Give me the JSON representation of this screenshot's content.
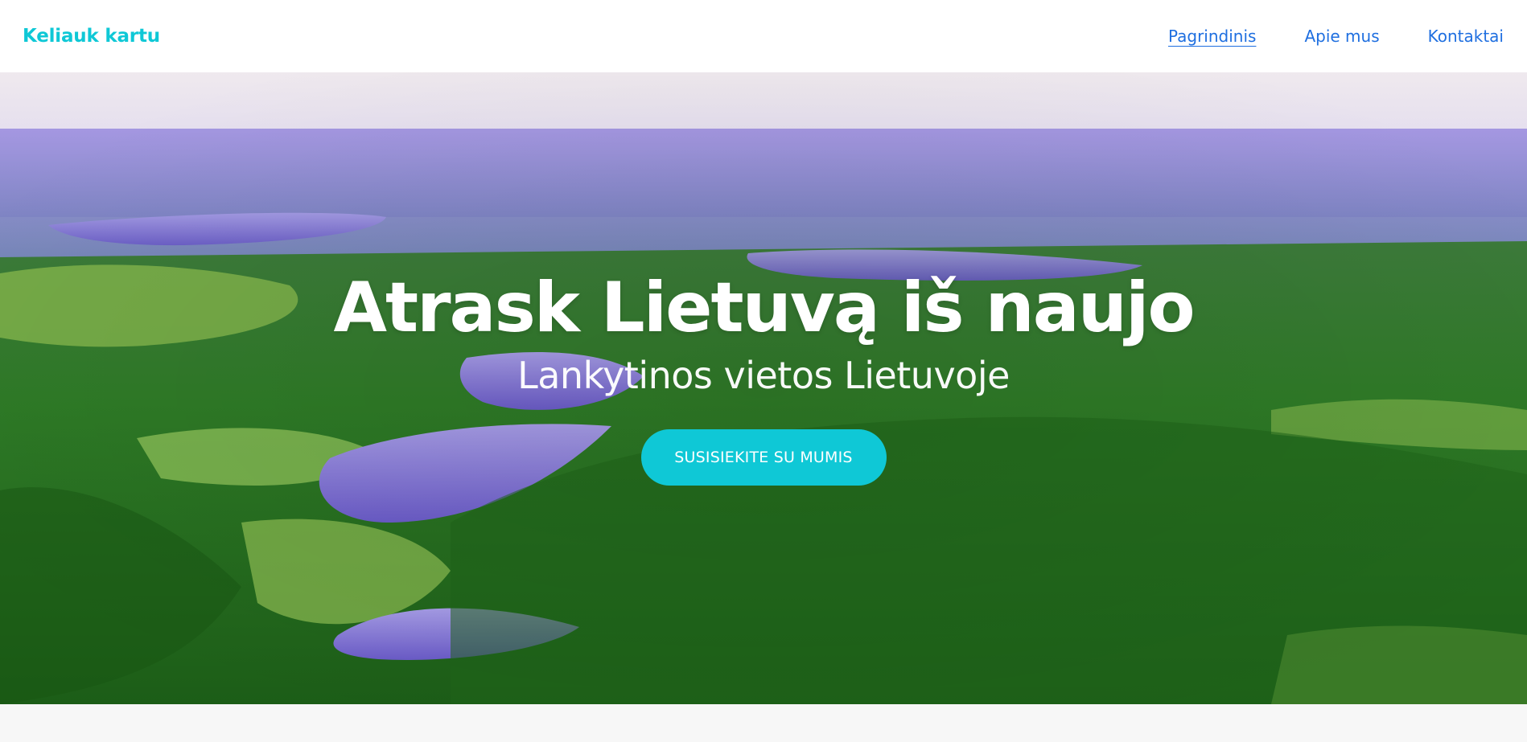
{
  "brand": {
    "logo_text": "Keliauk kartu",
    "accent_color": "#0fc8d6"
  },
  "nav": {
    "items": [
      {
        "label": "Pagrindinis",
        "active": true
      },
      {
        "label": "Apie mus",
        "active": false
      },
      {
        "label": "Kontaktai",
        "active": false
      }
    ],
    "link_color": "#1f6fe0"
  },
  "hero": {
    "title": "Atrask Lietuvą iš naujo",
    "subtitle": "Lankytinos vietos Lietuvoje",
    "cta_label": "SUSISIEKITE SU MUMIS"
  }
}
